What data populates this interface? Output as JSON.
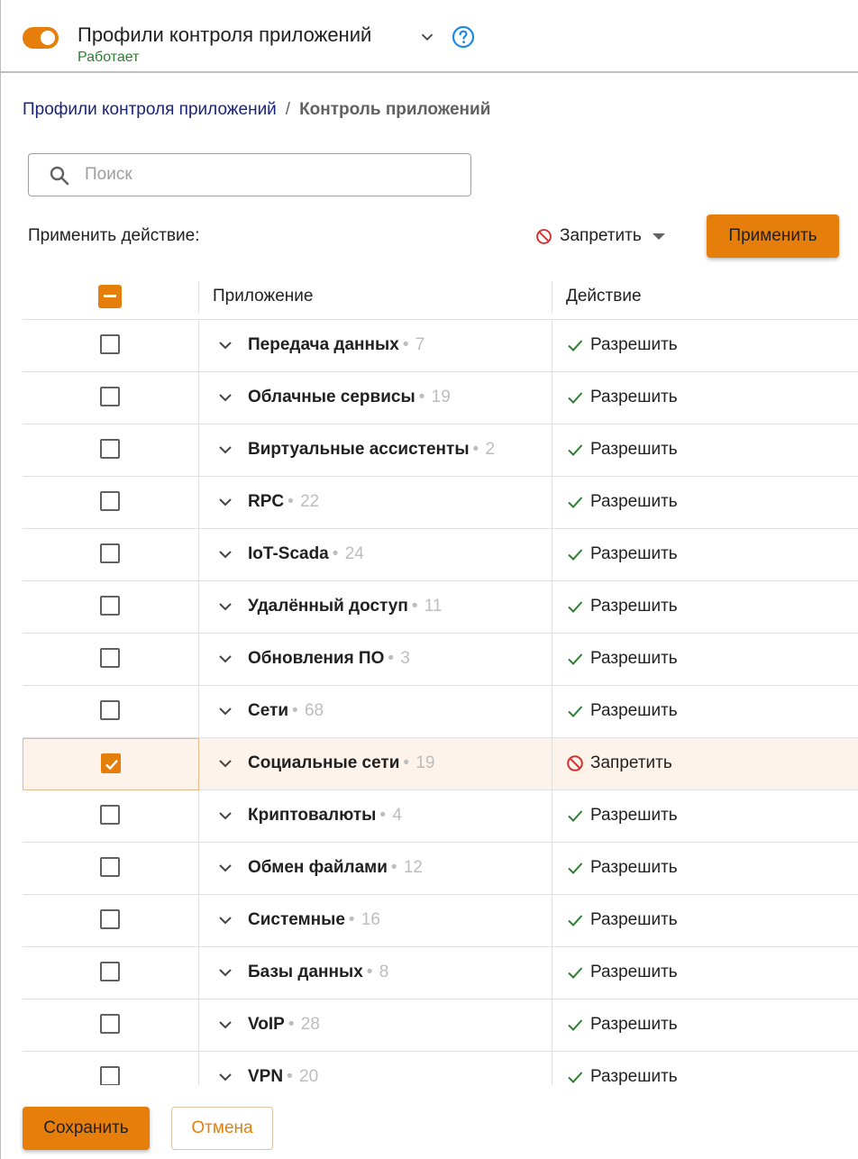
{
  "header": {
    "title": "Профили контроля приложений",
    "status": "Работает",
    "toggle_on": true,
    "accent_color": "#e67e0c",
    "status_color": "#2e7d32",
    "help_icon_color": "#1e88e5"
  },
  "breadcrumb": {
    "link": "Профили контроля приложений",
    "separator": "/",
    "current": "Контроль приложений"
  },
  "search": {
    "placeholder": "Поиск",
    "value": ""
  },
  "action_bar": {
    "label": "Применить действие:",
    "selected_action": "Запретить",
    "selected_icon": "ban-icon",
    "apply_label": "Применить"
  },
  "table": {
    "header": {
      "app": "Приложение",
      "action": "Действие",
      "select_all_state": "indeterminate"
    },
    "rows": [
      {
        "name": "Передача данных",
        "count": "7",
        "action": "Разрешить",
        "icon": "check-icon",
        "checked": false
      },
      {
        "name": "Облачные сервисы",
        "count": "19",
        "action": "Разрешить",
        "icon": "check-icon",
        "checked": false
      },
      {
        "name": "Виртуальные ассистенты",
        "count": "2",
        "action": "Разрешить",
        "icon": "check-icon",
        "checked": false
      },
      {
        "name": "RPC",
        "count": "22",
        "action": "Разрешить",
        "icon": "check-icon",
        "checked": false
      },
      {
        "name": "IoT-Scada",
        "count": "24",
        "action": "Разрешить",
        "icon": "check-icon",
        "checked": false
      },
      {
        "name": "Удалённый доступ",
        "count": "11",
        "action": "Разрешить",
        "icon": "check-icon",
        "checked": false
      },
      {
        "name": "Обновления ПО",
        "count": "3",
        "action": "Разрешить",
        "icon": "check-icon",
        "checked": false
      },
      {
        "name": "Сети",
        "count": "68",
        "action": "Разрешить",
        "icon": "check-icon",
        "checked": false
      },
      {
        "name": "Социальные сети",
        "count": "19",
        "action": "Запретить",
        "icon": "ban-icon",
        "checked": true
      },
      {
        "name": "Криптовалюты",
        "count": "4",
        "action": "Разрешить",
        "icon": "check-icon",
        "checked": false
      },
      {
        "name": "Обмен файлами",
        "count": "12",
        "action": "Разрешить",
        "icon": "check-icon",
        "checked": false
      },
      {
        "name": "Системные",
        "count": "16",
        "action": "Разрешить",
        "icon": "check-icon",
        "checked": false
      },
      {
        "name": "Базы данных",
        "count": "8",
        "action": "Разрешить",
        "icon": "check-icon",
        "checked": false
      },
      {
        "name": "VoIP",
        "count": "28",
        "action": "Разрешить",
        "icon": "check-icon",
        "checked": false
      },
      {
        "name": "VPN",
        "count": "20",
        "action": "Разрешить",
        "icon": "check-icon",
        "checked": false
      }
    ]
  },
  "footer": {
    "save_label": "Сохранить",
    "cancel_label": "Отмена"
  }
}
